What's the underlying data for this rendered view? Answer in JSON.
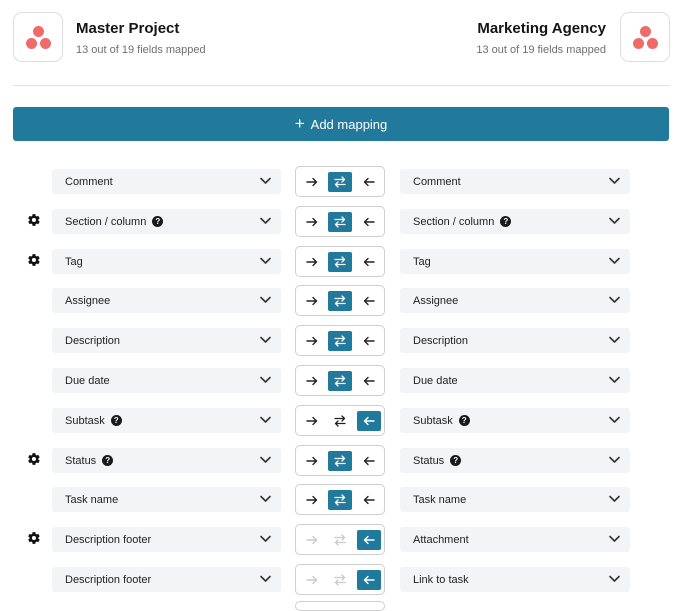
{
  "source": {
    "title": "Master Project",
    "subtitle": "13 out of 19 fields mapped"
  },
  "target": {
    "title": "Marketing Agency",
    "subtitle": "13 out of 19 fields mapped"
  },
  "add_mapping": {
    "label": "Add mapping"
  },
  "colors": {
    "accent": "#217a9b",
    "logo_dots": "#f06a6a",
    "field_bg": "#f3f4f6"
  },
  "mappings": [
    {
      "left": "Comment",
      "right": "Comment",
      "gear": false,
      "left_help": false,
      "right_help": false,
      "direction": "both",
      "disabled": false
    },
    {
      "left": "Section / column",
      "right": "Section / column",
      "gear": true,
      "left_help": true,
      "right_help": true,
      "direction": "both",
      "disabled": false
    },
    {
      "left": "Tag",
      "right": "Tag",
      "gear": true,
      "left_help": false,
      "right_help": false,
      "direction": "both",
      "disabled": false
    },
    {
      "left": "Assignee",
      "right": "Assignee",
      "gear": false,
      "left_help": false,
      "right_help": false,
      "direction": "both",
      "disabled": false
    },
    {
      "left": "Description",
      "right": "Description",
      "gear": false,
      "left_help": false,
      "right_help": false,
      "direction": "both",
      "disabled": false
    },
    {
      "left": "Due date",
      "right": "Due date",
      "gear": false,
      "left_help": false,
      "right_help": false,
      "direction": "both",
      "disabled": false
    },
    {
      "left": "Subtask",
      "right": "Subtask",
      "gear": false,
      "left_help": true,
      "right_help": true,
      "direction": "right-to-left",
      "disabled": false
    },
    {
      "left": "Status",
      "right": "Status",
      "gear": true,
      "left_help": true,
      "right_help": true,
      "direction": "both",
      "disabled": false
    },
    {
      "left": "Task name",
      "right": "Task name",
      "gear": false,
      "left_help": false,
      "right_help": false,
      "direction": "both",
      "disabled": false
    },
    {
      "left": "Description footer",
      "right": "Attachment",
      "gear": true,
      "left_help": false,
      "right_help": false,
      "direction": "right-to-left",
      "disabled": true
    },
    {
      "left": "Description footer",
      "right": "Link to task",
      "gear": false,
      "left_help": false,
      "right_help": false,
      "direction": "right-to-left",
      "disabled": true
    }
  ]
}
